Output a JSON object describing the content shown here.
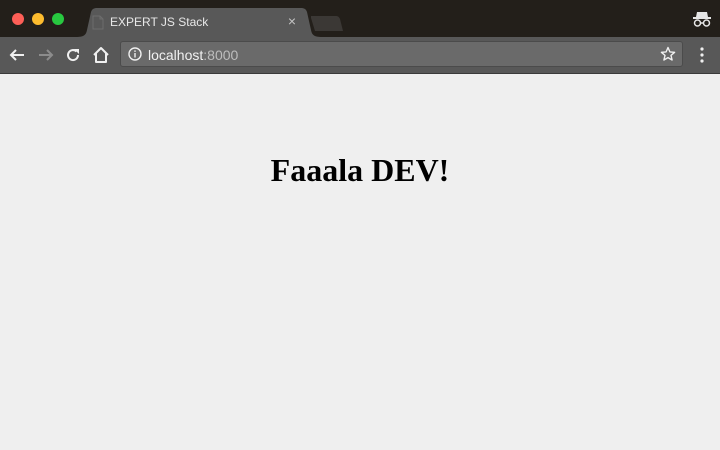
{
  "window": {
    "controls": [
      "close",
      "minimize",
      "maximize"
    ],
    "incognito_icon": "incognito-icon"
  },
  "tab": {
    "title": "EXPERT JS Stack",
    "close_glyph": "×",
    "favicon": "document-icon"
  },
  "toolbar": {
    "url_host": "localhost",
    "url_port": ":8000",
    "icons": [
      "back-arrow-icon",
      "forward-arrow-icon",
      "reload-icon",
      "home-icon",
      "info-icon",
      "star-icon",
      "more-vert-icon"
    ]
  },
  "page": {
    "heading": "Faaala DEV!"
  },
  "colors": {
    "titlebar": "#231f1a",
    "toolbar": "#585858",
    "page_background": "#efefef"
  }
}
